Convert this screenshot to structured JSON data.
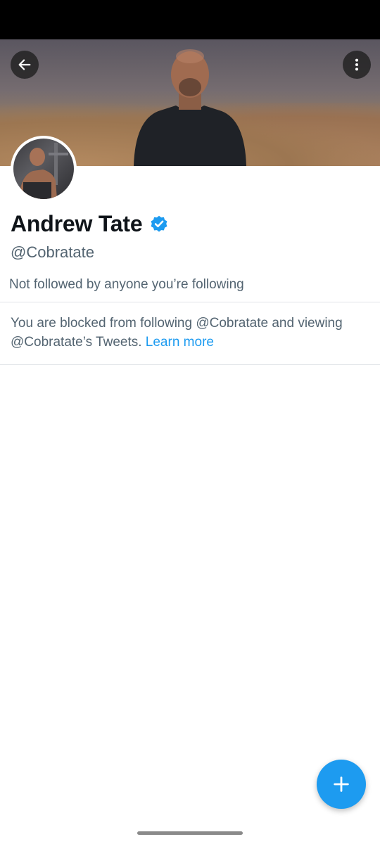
{
  "profile": {
    "name": "Andrew Tate",
    "handle": "@Cobratate",
    "verified": true,
    "followed_info": "Not followed by anyone you’re following"
  },
  "blocked_notice": {
    "text": "You are blocked from following @Cobratate and viewing @Cobratate’s Tweets.",
    "link_text": "Learn more"
  },
  "icons": {
    "back": "back-arrow-icon",
    "more": "more-vertical-icon",
    "verified": "verified-badge-icon",
    "compose": "plus-icon"
  },
  "colors": {
    "accent": "#1d9bf0",
    "secondary_text": "#536471",
    "primary_text": "#0f1419"
  }
}
